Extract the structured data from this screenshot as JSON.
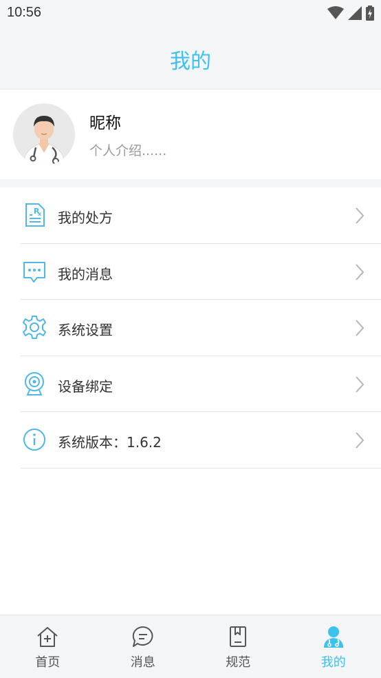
{
  "status_bar": {
    "time": "10:56"
  },
  "header": {
    "title": "我的"
  },
  "profile": {
    "nickname": "昵称",
    "intro": "个人介绍......"
  },
  "menu": [
    {
      "label": "我的处方",
      "icon": "prescription-icon"
    },
    {
      "label": "我的消息",
      "icon": "message-icon"
    },
    {
      "label": "系统设置",
      "icon": "settings-gear-icon"
    },
    {
      "label": "设备绑定",
      "icon": "camera-device-icon"
    },
    {
      "label": "系统版本：1.6.2",
      "icon": "info-icon"
    }
  ],
  "bottom_nav": [
    {
      "label": "首页",
      "icon": "home-icon",
      "active": false
    },
    {
      "label": "消息",
      "icon": "chat-icon",
      "active": false
    },
    {
      "label": "规范",
      "icon": "guideline-book-icon",
      "active": false
    },
    {
      "label": "我的",
      "icon": "doctor-profile-icon",
      "active": true
    }
  ],
  "colors": {
    "accent": "#3cc2ee",
    "icon_blue": "#4fb7e8",
    "background_gray": "#f4f5f7"
  }
}
